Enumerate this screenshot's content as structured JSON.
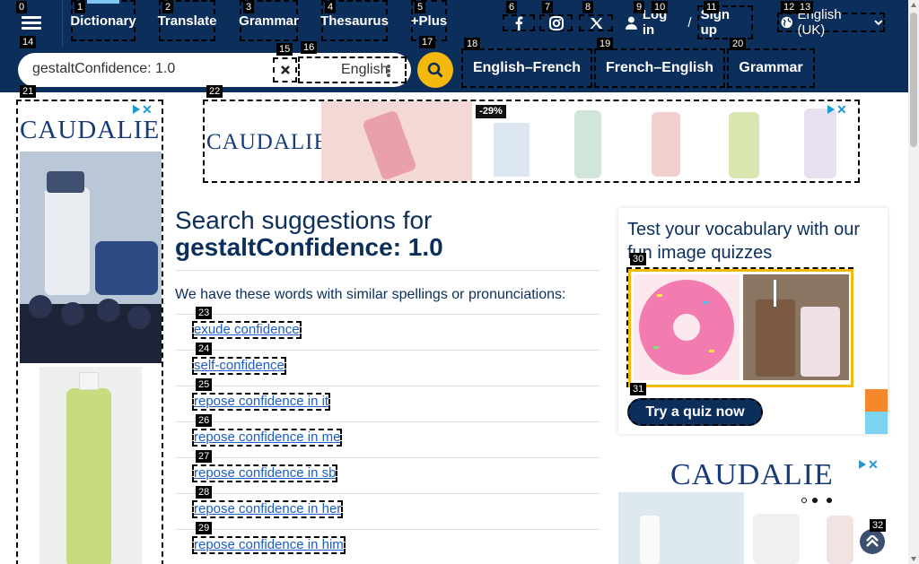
{
  "nav": {
    "items": [
      "Dictionary",
      "Translate",
      "Grammar",
      "Thesaurus",
      "+Plus"
    ],
    "login": "Log in",
    "sep": "/",
    "signup": "Sign up",
    "language": "English (UK)"
  },
  "social": [
    "facebook-icon",
    "instagram-icon",
    "x-icon"
  ],
  "search": {
    "value": "gestaltConfidence: 1.0",
    "language": "English"
  },
  "dictlinks": [
    "English–French",
    "French–English",
    "Grammar"
  ],
  "ads": {
    "brand": "CAUDALIE",
    "discount": "-29%"
  },
  "main": {
    "title_prefix": "Search suggestions for",
    "title_term": "gestaltConfidence: 1.0",
    "intro": "We have these words with similar spellings or pronunciations:",
    "suggestions": [
      "exude confidence",
      "self-confidence",
      "repose confidence in it",
      "repose confidence in me",
      "repose confidence in sb",
      "repose confidence in her",
      "repose confidence in him"
    ]
  },
  "quiz": {
    "title": "Test your vocabulary with our fun image quizzes",
    "button": "Try a quiz now"
  },
  "badges": [
    "0",
    "1",
    "2",
    "3",
    "4",
    "5",
    "6",
    "7",
    "8",
    "9",
    "10",
    "11",
    "12",
    "13",
    "14",
    "15",
    "16",
    "17",
    "18",
    "19",
    "20",
    "21",
    "22",
    "23",
    "24",
    "25",
    "26",
    "27",
    "28",
    "29",
    "30",
    "31",
    "32"
  ],
  "colors": {
    "navy": "#0b2e5b",
    "accent": "#f5b80f",
    "link": "#1d5dc4"
  }
}
